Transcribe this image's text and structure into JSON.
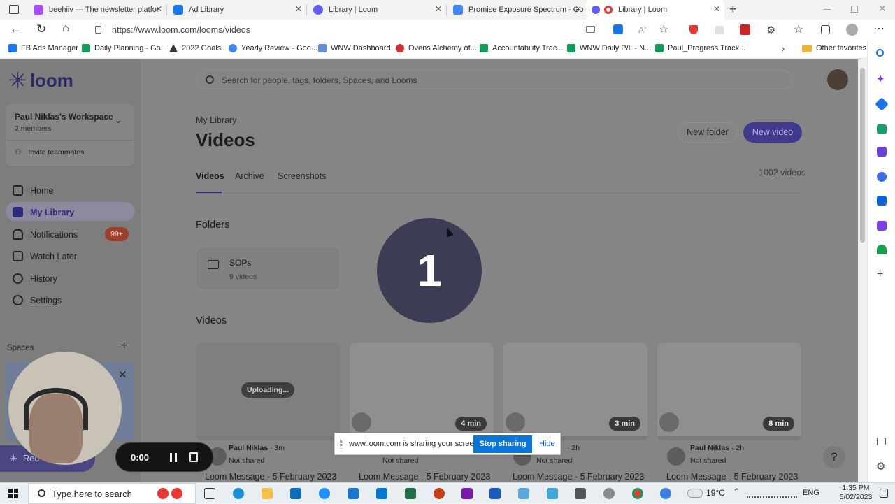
{
  "browser": {
    "tabs": [
      {
        "label": "beehiiv — The newsletter platfor",
        "color": "#a64dff"
      },
      {
        "label": "Ad Library",
        "color": "#1877f2"
      },
      {
        "label": "Library | Loom",
        "color": "#625df5"
      },
      {
        "label": "Promise Exposure Spectrum - Go",
        "color": "#4285f4"
      },
      {
        "label": "Library | Loom",
        "color": "#e53935"
      }
    ],
    "url": "https://www.loom.com/looms/videos",
    "bookmarks": [
      {
        "label": "FB Ads Manager",
        "color": "#1877f2"
      },
      {
        "label": "Daily Planning - Go...",
        "color": "#0f9d58"
      },
      {
        "label": "2022 Goals",
        "color": "#333"
      },
      {
        "label": "Yearly Review - Goo...",
        "color": "#4285f4"
      },
      {
        "label": "WNW Dashboard",
        "color": "#5e8fd6"
      },
      {
        "label": "Ovens Alchemy of...",
        "color": "#d32f2f"
      },
      {
        "label": "Accountability Trac...",
        "color": "#0f9d58"
      },
      {
        "label": "WNW Daily P/L - N...",
        "color": "#0f9d58"
      },
      {
        "label": "Paul_Progress Track...",
        "color": "#0f9d58"
      },
      {
        "label": "Other favorites",
        "color": "#e8b43a"
      }
    ]
  },
  "sidebar": {
    "logo": "loom",
    "workspace": "Paul Niklas's Workspace",
    "members": "2 members",
    "invite": "Invite teammates",
    "nav": [
      {
        "label": "Home"
      },
      {
        "label": "My Library"
      },
      {
        "label": "Notifications",
        "badge": "99+"
      },
      {
        "label": "Watch Later"
      },
      {
        "label": "History"
      },
      {
        "label": "Settings"
      }
    ],
    "spaces": "Spaces"
  },
  "main": {
    "search_placeholder": "Search for people, tags, folders, Spaces, and Looms",
    "crumb": "My Library",
    "title": "Videos",
    "new_folder": "New folder",
    "new_video": "New video",
    "tabs": [
      "Videos",
      "Archive",
      "Screenshots"
    ],
    "count": "1002 videos",
    "folders_heading": "Folders",
    "folder": {
      "name": "SOPs",
      "count": "9 videos"
    },
    "videos_heading": "Videos",
    "cards": [
      {
        "overlay": "Uploading...",
        "author": "Paul Niklas",
        "time": "3m",
        "shared": "Not shared",
        "title": "Loom Message - 5 February 2023"
      },
      {
        "overlay": "4 min",
        "author": "",
        "time": "",
        "shared": "Not shared",
        "title": "Loom Message - 5 February 2023"
      },
      {
        "overlay": "3 min",
        "author": "",
        "time": "2h",
        "shared": "Not shared",
        "title": "Loom Message - 5 February 2023"
      },
      {
        "overlay": "8 min",
        "author": "Paul Niklas",
        "time": "2h",
        "shared": "Not shared",
        "title": "Loom Message - 5 February 2023"
      }
    ]
  },
  "countdown": "1",
  "recorder": {
    "time": "0:00",
    "rec_label": "Rec"
  },
  "share_bar": {
    "text": "www.loom.com is sharing your screen.",
    "stop": "Stop sharing",
    "hide": "Hide"
  },
  "help": "?",
  "taskbar": {
    "search": "Type here to search",
    "weather": "19°C",
    "lang": "ENG",
    "time": "1:35 PM",
    "date": "5/02/2023"
  }
}
